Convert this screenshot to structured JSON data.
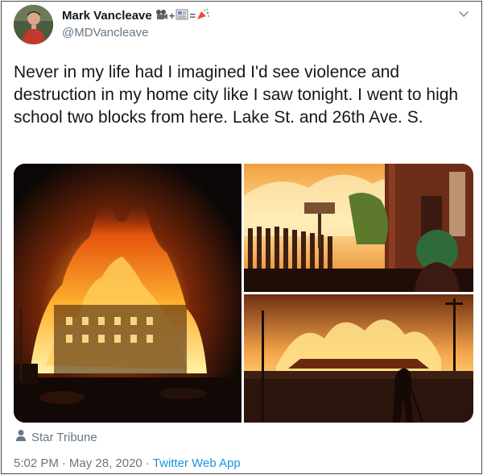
{
  "user": {
    "display_name": "Mark Vancleave",
    "handle": "@MDVancleave",
    "name_emoji": [
      "movie-camera-icon",
      "+",
      "newspaper-icon",
      "=",
      "party-popper-icon"
    ]
  },
  "tweet": {
    "text": "Never in my life had I imagined I'd see violence and destruction in my home city like I saw tonight. I went to high school two blocks from here. Lake St. and 26th Ave. S."
  },
  "media": {
    "source_label": "Star Tribune",
    "photo_count": 3
  },
  "meta": {
    "time": "5:02 PM",
    "separator": "·",
    "date": "May 28, 2020",
    "app": "Twitter Web App"
  },
  "colors": {
    "text_primary": "#14171a",
    "text_secondary": "#657786",
    "link": "#1b95e0"
  }
}
